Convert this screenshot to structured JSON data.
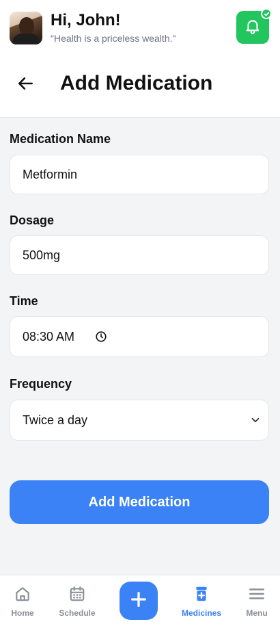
{
  "header": {
    "greeting": "Hi, John!",
    "quote": "\"Health is a priceless wealth.\"",
    "title": "Add Medication"
  },
  "form": {
    "name_label": "Medication Name",
    "name_value": "Metformin",
    "dosage_label": "Dosage",
    "dosage_value": "500mg",
    "time_label": "Time",
    "time_value": "08:30 AM",
    "frequency_label": "Frequency",
    "frequency_value": "Twice a day",
    "submit_label": "Add Medication"
  },
  "nav": {
    "home": "Home",
    "schedule": "Schedule",
    "medicines": "Medicines",
    "menu": "Menu"
  },
  "colors": {
    "accent": "#3b82f6",
    "success": "#22c55e",
    "nav_inactive": "#8a8f98"
  },
  "icons": [
    "avatar",
    "bell-icon",
    "check-icon",
    "back-arrow-icon",
    "clock-icon",
    "chevron-down-icon",
    "home-icon",
    "calendar-icon",
    "plus-icon",
    "medicine-bottle-icon",
    "hamburger-menu-icon"
  ]
}
